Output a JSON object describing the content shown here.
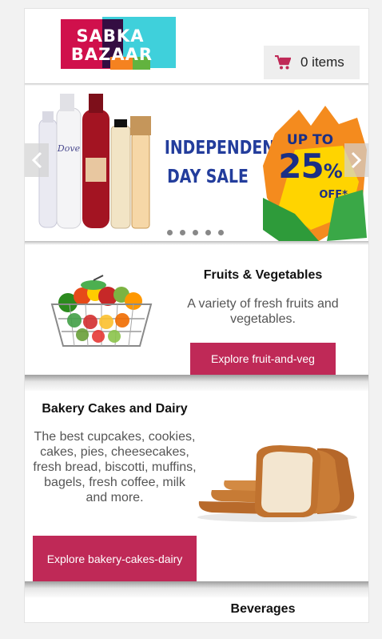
{
  "header": {
    "logo": {
      "line1": "SABKA",
      "line2": "BAZAAR"
    },
    "cart": {
      "count_label": "0 items"
    }
  },
  "carousel": {
    "slide_title_line1": "INDEPENDENCE",
    "slide_title_line2": "DAY SALE",
    "promo_line1": "UP TO",
    "promo_value": "25",
    "promo_percent": "%",
    "promo_line3": "OFF*",
    "dot_count": 5
  },
  "categories": [
    {
      "title": "Fruits & Vegetables",
      "description": "A variety of fresh fruits and vegetables.",
      "button_label": "Explore fruit-and-veg"
    },
    {
      "title": "Bakery Cakes and Dairy",
      "description": "The best cupcakes, cookies, cakes, pies, cheesecakes, fresh bread, biscotti, muffins, bagels, fresh coffee, milk and more.",
      "button_label": "Explore bakery-cakes-dairy"
    },
    {
      "title": "Beverages"
    }
  ],
  "colors": {
    "accent": "#bf2957",
    "logo_red": "#d0104c",
    "logo_cyan": "#3fd0db",
    "logo_orange": "#f58220",
    "logo_green": "#62b33f",
    "banner_blue": "#233d9c"
  }
}
